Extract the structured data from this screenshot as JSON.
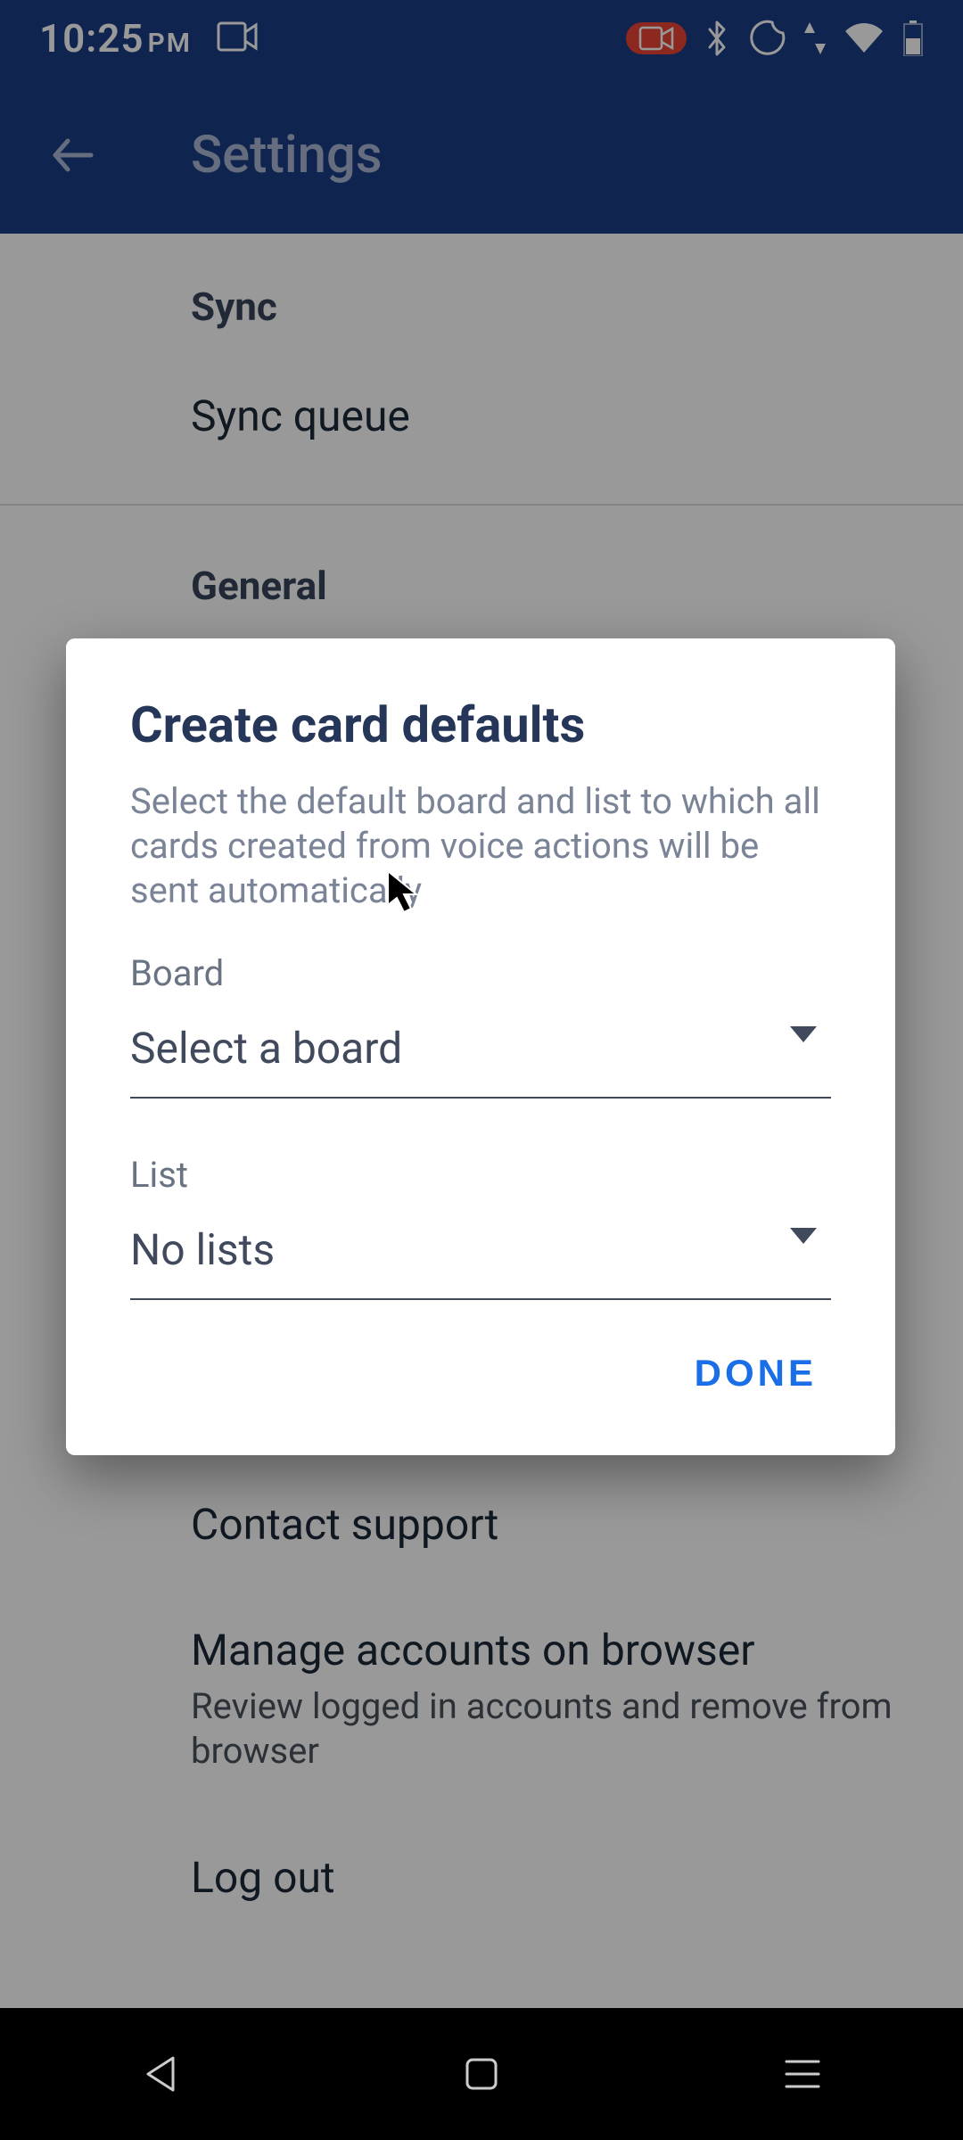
{
  "status": {
    "time": "10:25",
    "ampm": "PM"
  },
  "appbar": {
    "title": "Settings"
  },
  "sections": {
    "sync": {
      "header": "Sync",
      "item1": "Sync queue"
    },
    "general": {
      "header": "General"
    },
    "support_items": {
      "contact": "Contact support",
      "manage_title": "Manage accounts on browser",
      "manage_sub": "Review logged in accounts and remove from browser",
      "logout": "Log out"
    }
  },
  "dialog": {
    "title": "Create card defaults",
    "description": "Select the default board and list to which all cards created from voice actions will be sent automatically",
    "board_label": "Board",
    "board_value": "Select a board",
    "list_label": "List",
    "list_value": "No lists",
    "done": "DONE"
  }
}
